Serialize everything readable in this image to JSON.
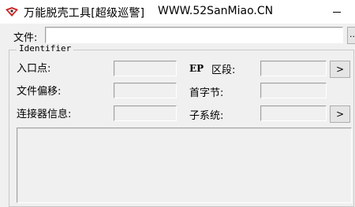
{
  "window": {
    "title": "万能脱壳工具[超级巡警]",
    "url": "WWW.52SanMiao.CN",
    "minimize_icon": "minimize-icon"
  },
  "file": {
    "label": "文件:",
    "value": "",
    "browse_label": "..."
  },
  "identifier": {
    "legend": "Identifier",
    "entry_point_label": "入口点:",
    "entry_point_value": "",
    "file_offset_label": "文件偏移:",
    "file_offset_value": "",
    "linker_info_label": "连接器信息:",
    "linker_info_value": "",
    "ep_label": "EP",
    "section_label": "区段:",
    "section_value": "",
    "section_button": ">",
    "first_bytes_label": "首字节:",
    "first_bytes_value": "",
    "subsystem_label": "子系统:",
    "subsystem_value": "",
    "subsystem_button": ">"
  },
  "output": {
    "text": ""
  },
  "colors": {
    "background": "#f0f0f0",
    "titlebar": "#ffffff",
    "icon_red": "#cc2222"
  }
}
